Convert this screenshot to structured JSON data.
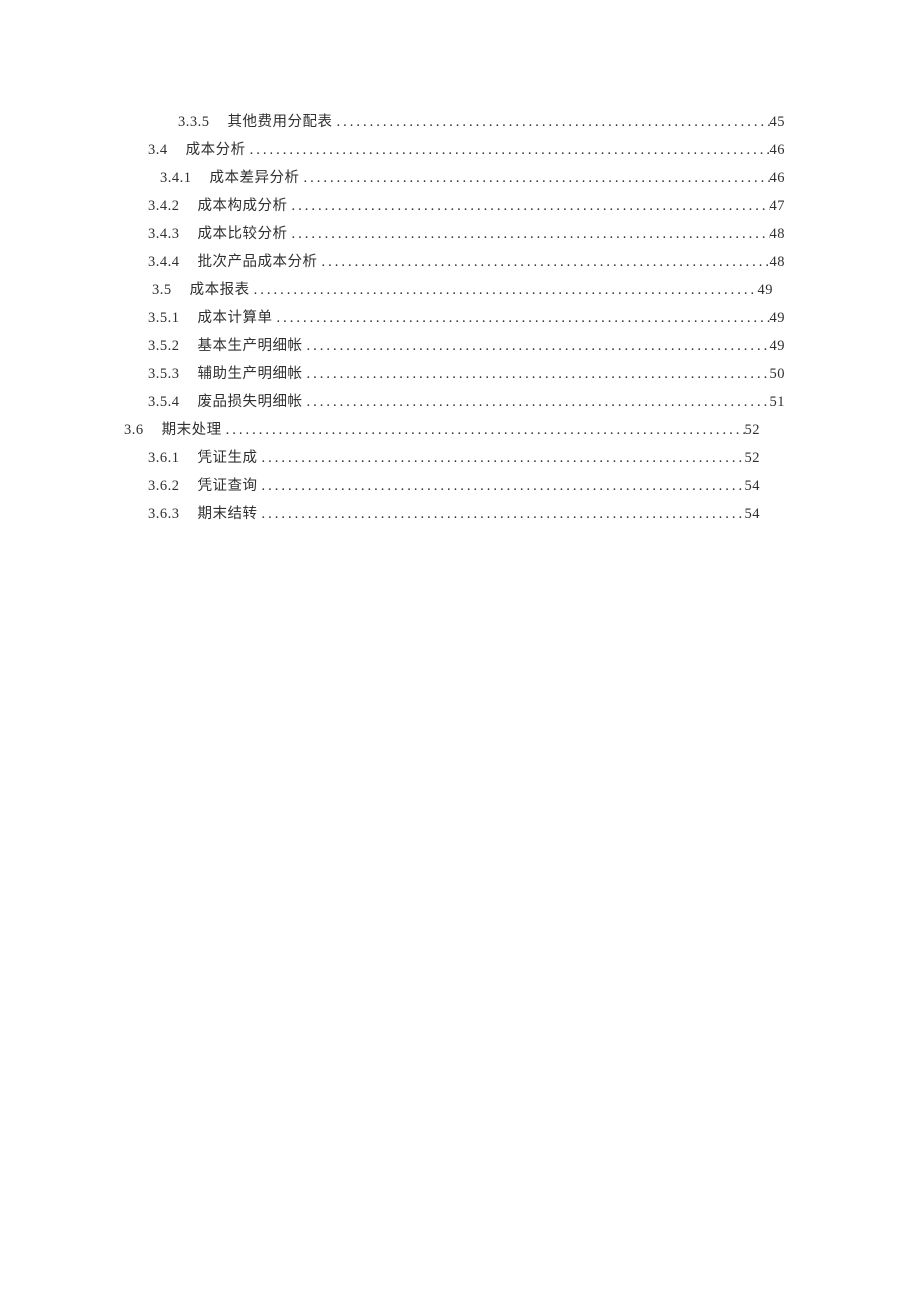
{
  "toc": [
    {
      "level": "lv-a",
      "number": "3.3.5",
      "title": "其他费用分配表",
      "page": "45"
    },
    {
      "level": "lv-b",
      "number": "3.4",
      "title": "成本分析",
      "page": "46"
    },
    {
      "level": "lv-c",
      "number": "3.4.1",
      "title": "成本差异分析",
      "page": "46"
    },
    {
      "level": "lv-d",
      "number": "3.4.2",
      "title": "成本构成分析",
      "page": "47"
    },
    {
      "level": "lv-d",
      "number": "3.4.3",
      "title": "成本比较分析",
      "page": "48"
    },
    {
      "level": "lv-d",
      "number": "3.4.4",
      "title": "批次产品成本分析",
      "page": "48"
    },
    {
      "level": "lv-e",
      "number": "3.5",
      "title": "成本报表",
      "page": "49"
    },
    {
      "level": "lv-d",
      "number": "3.5.1",
      "title": "成本计算单",
      "page": "49"
    },
    {
      "level": "lv-d",
      "number": "3.5.2",
      "title": "基本生产明细帐",
      "page": "49"
    },
    {
      "level": "lv-d",
      "number": "3.5.3",
      "title": "辅助生产明细帐",
      "page": "50"
    },
    {
      "level": "lv-d",
      "number": "3.5.4",
      "title": "废品损失明细帐",
      "page": "51"
    },
    {
      "level": "lv-f",
      "number": "3.6",
      "title": "期末处理",
      "page": "52"
    },
    {
      "level": "lv-g",
      "number": "3.6.1",
      "title": "凭证生成",
      "page": "52"
    },
    {
      "level": "lv-g",
      "number": "3.6.2",
      "title": "凭证查询",
      "page": "54"
    },
    {
      "level": "lv-g",
      "number": "3.6.3",
      "title": "期末结转",
      "page": "54"
    }
  ]
}
